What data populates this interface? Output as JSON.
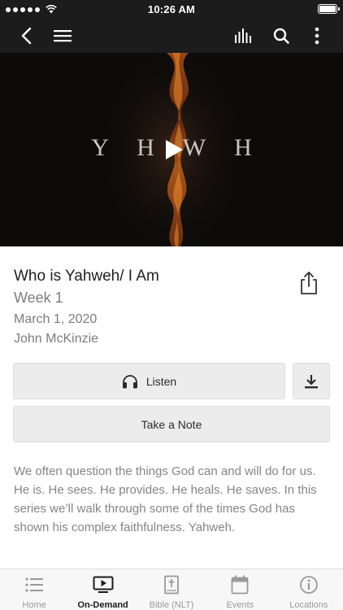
{
  "status_bar": {
    "time": "10:26 AM"
  },
  "nav": {
    "back_icon": "chevron-left-icon",
    "menu_icon": "hamburger-menu-icon",
    "audio_icon": "audio-bars-icon",
    "search_icon": "search-icon",
    "more_icon": "vertical-ellipsis-icon"
  },
  "video": {
    "overlay_title": "Y H W H",
    "play_icon": "play-icon"
  },
  "sermon": {
    "title": "Who is Yahweh/ I Am",
    "series_part": "Week 1",
    "date": "March 1, 2020",
    "speaker": "John McKinzie",
    "share_icon": "share-icon"
  },
  "actions": {
    "listen_label": "Listen",
    "listen_icon": "headphones-icon",
    "download_icon": "download-icon",
    "note_label": "Take a Note"
  },
  "description": "We often question the things God can and will do for us. He is. He sees. He provides. He heals. He saves. In this series we’ll walk through some of the times God has shown his complex faithfulness. Yahweh.",
  "tabs": [
    {
      "label": "Home",
      "icon": "list-icon",
      "active": false
    },
    {
      "label": "On-Demand",
      "icon": "tv-play-icon",
      "active": true
    },
    {
      "label": "Bible (NLT)",
      "icon": "bible-icon",
      "active": false
    },
    {
      "label": "Events",
      "icon": "calendar-icon",
      "active": false
    },
    {
      "label": "Locations",
      "icon": "info-icon",
      "active": false
    }
  ],
  "colors": {
    "header_bg": "#1c1c1c",
    "button_bg": "#ececec",
    "muted_text": "#7d7d7d",
    "tab_bar_bg": "#f7f7f7"
  }
}
